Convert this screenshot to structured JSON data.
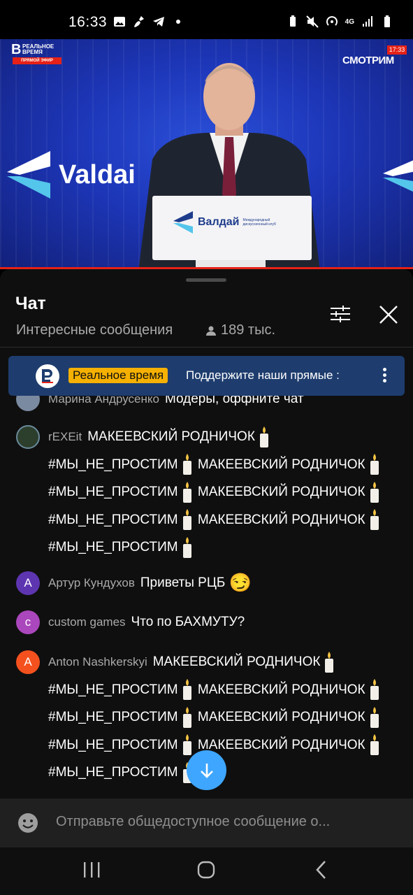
{
  "status_bar": {
    "time": "16:33",
    "network": "4G"
  },
  "video": {
    "channel_logo_line1": "РЕАЛЬНОЕ",
    "channel_logo_line2": "ВРЕМЯ",
    "live_label": "ПРЯМОЙ ЭФИР",
    "broadcaster": "СМОТРИМ",
    "clock": "17:33",
    "banner_text": "Valdai",
    "podium_name": "Валдай",
    "podium_sub": "Международный дискуссионный клуб"
  },
  "chat": {
    "title": "Чат",
    "mode": "Интересные сообщения",
    "viewers": "189 тыс.",
    "pinned": {
      "author": "Реальное время",
      "text": "Поддержите наши прямые :"
    },
    "messages": [
      {
        "author": "Марина Андрусенко",
        "text": "Модеры, оффните чат",
        "avatar": "",
        "avatar_color": "#7a8aa0"
      },
      {
        "author": "rEXEit",
        "lines": [
          "МАКЕЕВСКИЙ РОДНИЧОК",
          "#МЫ_НЕ_ПРОСТИМ",
          "МАКЕЕВСКИЙ РОДНИЧОК",
          "#МЫ_НЕ_ПРОСТИМ",
          "МАКЕЕВСКИЙ РОДНИЧОК",
          "#МЫ_НЕ_ПРОСТИМ",
          "МАКЕЕВСКИЙ РОДНИЧОК",
          "#МЫ_НЕ_ПРОСТИМ"
        ],
        "avatar": "",
        "avatar_color": "#2c3e2c"
      },
      {
        "author": "Артур Кундухов",
        "text": "Приветы РЦБ",
        "emoji": "😏",
        "avatar": "А",
        "avatar_color": "#5e35b1"
      },
      {
        "author": "custom games",
        "text": "Что по БАХМУТУ?",
        "avatar": "c",
        "avatar_color": "#ab47bc"
      },
      {
        "author": "Anton Nashkerskyi",
        "lines": [
          "МАКЕЕВСКИЙ РОДНИЧОК",
          "#МЫ_НЕ_ПРОСТИМ",
          "МАКЕЕВСКИЙ РОДНИЧОК",
          "#МЫ_НЕ_ПРОСТИМ",
          "МАКЕЕВСКИЙ РОДНИЧОК",
          "#МЫ_НЕ_ПРОСТИМ",
          "МАКЕЕВСКИЙ РОДНИЧОК",
          "#МЫ_НЕ_ПРОСТИМ"
        ],
        "avatar": "A",
        "avatar_color": "#f4511e"
      }
    ],
    "input_placeholder": "Отправьте общедоступное сообщение о..."
  },
  "icons": {
    "filter": "sliders-icon",
    "close": "close-icon",
    "viewers": "person-icon",
    "more": "more-vert-icon",
    "scroll": "arrow-down-icon",
    "emoji": "emoji-icon"
  },
  "colors": {
    "accent": "#3ea6ff",
    "pinned_bg": "#1e3d6e",
    "author_badge": "#f5b000",
    "live_red": "#e62117"
  }
}
